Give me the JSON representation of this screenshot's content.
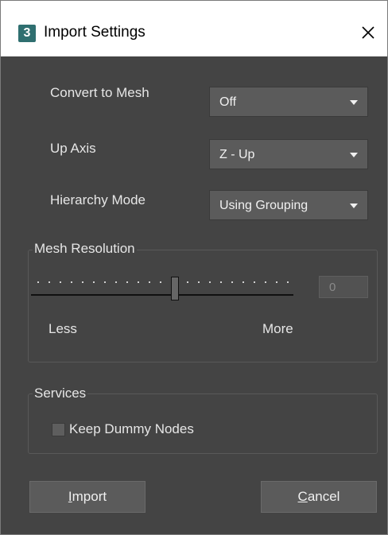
{
  "window": {
    "icon_text": "3",
    "title": "Import Settings",
    "close_symbol": "✕"
  },
  "settings": {
    "convert_to_mesh": {
      "label": "Convert to Mesh",
      "value": "Off"
    },
    "up_axis": {
      "label": "Up Axis",
      "value": "Z - Up"
    },
    "hierarchy_mode": {
      "label": "Hierarchy Mode",
      "value": "Using Grouping"
    }
  },
  "mesh_resolution": {
    "legend": "Mesh Resolution",
    "value": "0",
    "less_label": "Less",
    "more_label": "More"
  },
  "services": {
    "legend": "Services",
    "keep_dummy_nodes_label": "Keep Dummy Nodes",
    "keep_dummy_nodes_checked": false
  },
  "buttons": {
    "import_mnemonic": "I",
    "import_rest": "mport",
    "cancel_mnemonic": "C",
    "cancel_rest": "ancel"
  },
  "colors": {
    "panel_bg": "#444444",
    "control_bg": "#5b5b5b",
    "icon_accent": "#2f6f70"
  }
}
